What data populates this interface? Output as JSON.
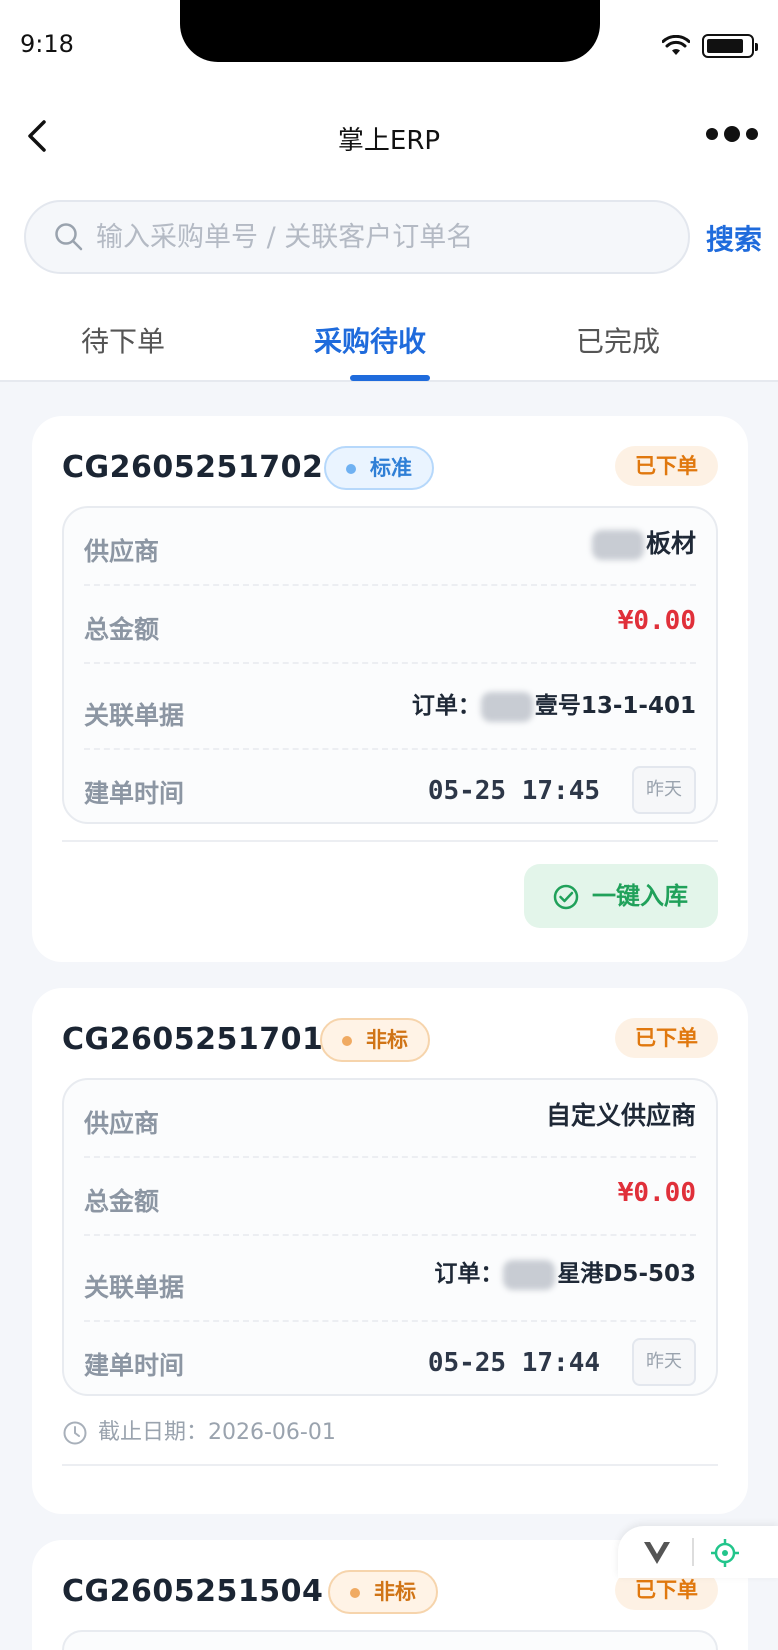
{
  "status_bar": {
    "time": "9:18",
    "battery_level": 0.85
  },
  "nav": {
    "title": "掌上ERP"
  },
  "search": {
    "placeholder": "输入采购单号 / 关联客户订单名",
    "button": "搜索"
  },
  "tabs": [
    {
      "label": "待下单",
      "active": false
    },
    {
      "label": "采购待收",
      "active": true
    },
    {
      "label": "已完成",
      "active": false
    }
  ],
  "orders": [
    {
      "order_no": "CG2605251702",
      "type_tag": "标准",
      "status": "已下单",
      "supplier_label": "供应商",
      "supplier": "板材",
      "amount_label": "总金额",
      "amount": "¥0.00",
      "related_label": "关联单据",
      "related_prefix": "订单：",
      "related": "壹号13-1-401",
      "created_label": "建单时间",
      "created": "05-25 17:45",
      "day_badge": "昨天",
      "action": "一键入库"
    },
    {
      "order_no": "CG2605251701",
      "type_tag": "非标",
      "status": "已下单",
      "supplier_label": "供应商",
      "supplier": "自定义供应商",
      "amount_label": "总金额",
      "amount": "¥0.00",
      "related_label": "关联单据",
      "related_prefix": "订单：",
      "related": "星港D5-503",
      "created_label": "建单时间",
      "created": "05-25 17:44",
      "day_badge": "昨天",
      "deadline": "截止日期：2026-06-01"
    },
    {
      "order_no": "CG2605251504",
      "type_tag": "非标",
      "status": "已下单"
    }
  ],
  "colors": {
    "accent": "#1f6bdc",
    "money": "#e0303a",
    "status": "#e0780e",
    "success": "#20a15a"
  }
}
